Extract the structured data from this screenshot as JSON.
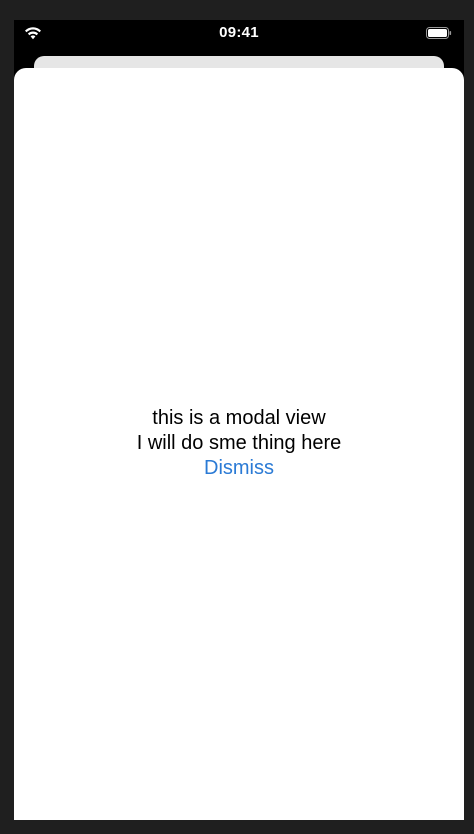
{
  "status_bar": {
    "time": "09:41",
    "icons": [
      "wifi-icon",
      "battery-icon"
    ]
  },
  "modal": {
    "line1": "this is a modal view",
    "line2": "I will do sme thing here",
    "dismiss_label": "Dismiss"
  },
  "colors": {
    "outer_background": "#1f1f1f",
    "device_background": "#000000",
    "sheet_background": "#ffffff",
    "back_sheet": "#e6e6e6",
    "link": "#2a7ad5"
  }
}
